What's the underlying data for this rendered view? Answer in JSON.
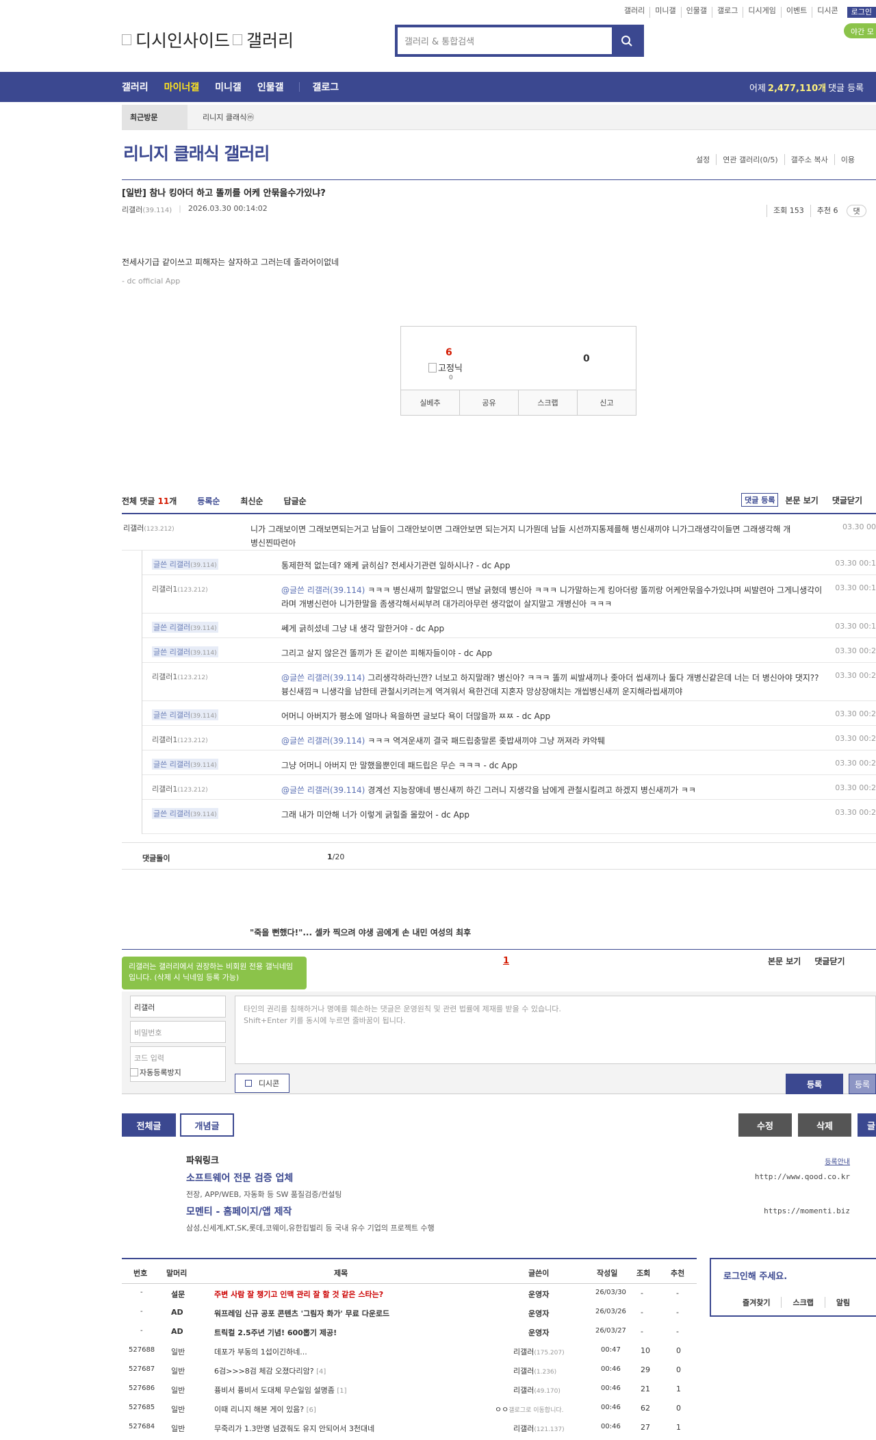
{
  "gnb": [
    "갤러리",
    "미니갤",
    "인물갤",
    "갤로그",
    "디시게임",
    "이벤트",
    "디시콘"
  ],
  "gnb_login": "로그인",
  "logo": [
    "디시인사이드",
    "갤러리"
  ],
  "search_placeholder": "갤러리 & 통합검색",
  "night_mode": "야간 모",
  "nav": {
    "items": [
      "갤러리",
      "마이너갤",
      "미니갤",
      "인물갤",
      "갤로그"
    ],
    "yesterday_prefix": "어제",
    "yesterday_count": "2,477,110개",
    "yesterday_suffix": "댓글 등록"
  },
  "recent": {
    "label": "최근방문",
    "item": "리니지 클래식ⓜ"
  },
  "gallery_title": "리니지 클래식 갤러리",
  "gallery_menu": [
    "설정",
    "연관 갤러리(0/5)",
    "갤주소 복사",
    "이용"
  ],
  "post": {
    "title": "[일반] 참나 킹아더 하고 똘끼를 어케 안묶을수가있냐?",
    "author": "리갤러",
    "author_ip": "(39.114)",
    "date": "2026.03.30 00:14:02",
    "views": "조회 153",
    "recommends": "추천 6",
    "body": "전세사기급 같이쓰고 피해자는 살자하고 그러는데 졸라어이없네",
    "app": "- dc official App"
  },
  "recommend": {
    "up": "6",
    "fixed": "고정닉",
    "fixed_count": "0",
    "down": "0",
    "buttons": [
      "실베추",
      "공유",
      "스크랩",
      "신고"
    ]
  },
  "comments_header": {
    "all": "전체 댓글",
    "count": "11",
    "suffix": "개",
    "sorts": [
      "등록순",
      "최신순",
      "답글순"
    ],
    "register": "댓글 등록",
    "view": "본문 보기",
    "close": "댓글닫기"
  },
  "main_comment": {
    "nick": "리갤러",
    "ip": "(123.212)",
    "text": "니가 그래보이면 그래보면되는거고 남들이 그래안보이면 그래안보면 되는거지 니가뭔데 남들 시선까지통제를해 병신새끼야 니가그래생각이들면 그래생각해 개병신찐따련아",
    "date": "03.30 00"
  },
  "replies": [
    {
      "nick": "글쓴 리갤러",
      "ip": "(39.114)",
      "gl": true,
      "at": "",
      "text": "통제한적 없는데? 왜케 긁히심? 전세사기관련 일하시나? - dc App",
      "date": "03.30 00:1"
    },
    {
      "nick": "리갤러1",
      "ip": "(123.212)",
      "gl": false,
      "at": "@글쓴 리갤러(39.114)",
      "text": " ㅋㅋㅋ 병신새끼 할말없으니 맨날 긁혔데 병신아 ㅋㅋㅋ 니가말하는게 킹아더랑 똘끼랑 어케안묶을수가있냐며 씨발련아 그게니생각이라며 개병신련아 니가한말을 좀생각해서씨부려 대가리아무런 생각없이 살지말고 개병신아 ㅋㅋㅋ",
      "date": "03.30 00:1"
    },
    {
      "nick": "글쓴 리갤러",
      "ip": "(39.114)",
      "gl": true,
      "at": "",
      "text": "쎄게 긁히셨네 그냥 내 생각 말한거야 - dc App",
      "date": "03.30 00:1"
    },
    {
      "nick": "글쓴 리갤러",
      "ip": "(39.114)",
      "gl": true,
      "at": "",
      "text": "그리고 살지 않은건 똘끼가 돈 같이쓴 피해자들이야 - dc App",
      "date": "03.30 00:2"
    },
    {
      "nick": "리갤러1",
      "ip": "(123.212)",
      "gl": false,
      "at": "@글쓴 리갤러(39.114)",
      "text": " 그리생각하라닌깐? 너보고 하지말래? 병신아? ㅋㅋㅋ 똘끼 씨발새끼나 좆아더 씹새끼나 둘다 개병신같은데 너는 더 병신아야 댓지?? 븅신새낌ㅋ 니생각을 남한테 관철시키려는게 역겨워서 욕한건데 지혼자 망상장애치는 개씹병신새끼 운지해라씹새끼야",
      "date": "03.30 00:2"
    },
    {
      "nick": "글쓴 리갤러",
      "ip": "(39.114)",
      "gl": true,
      "at": "",
      "text": "어머니 아버지가 평소에 얼마나 욕을하면 글보다 욕이 더많을까 ㅉㅉ - dc App",
      "date": "03.30 00:2"
    },
    {
      "nick": "리갤러1",
      "ip": "(123.212)",
      "gl": false,
      "at": "@글쓴 리갤러(39.114)",
      "text": " ㅋㅋㅋ 역겨운새끼 결국 패드립충말론 좆밥새끼야 그냥 꺼져라 캬악퉤",
      "date": "03.30 00:2"
    },
    {
      "nick": "글쓴 리갤러",
      "ip": "(39.114)",
      "gl": true,
      "at": "",
      "text": "그냥 어머니 아버지 만 말했을뿐인데 패드립은 무슨 ㅋㅋㅋ - dc App",
      "date": "03.30 00:2"
    },
    {
      "nick": "리갤러1",
      "ip": "(123.212)",
      "gl": false,
      "at": "@글쓴 리갤러(39.114)",
      "text": " 경계선 지능장애네 병신새끼 하긴 그러니 지생각을 남에게 관철시킬려고 하겠지 병신새끼가 ㅋㅋ",
      "date": "03.30 00:2"
    },
    {
      "nick": "글쓴 리갤러",
      "ip": "(39.114)",
      "gl": true,
      "at": "",
      "text": "그래 내가 미안해 너가 이렇게 긁힐줄 몰랐어 - dc App",
      "date": "03.30 00:2"
    }
  ],
  "comment_footer": {
    "label": "댓글돌이",
    "page": "1",
    "total": "/20"
  },
  "news": "\"죽을 뻔했다!\"... 셀카 찍으려 야생 곰에게 손 내민 여성의 최후",
  "tip": "리갤러는 갤러리에서 권장하는 비회원 전용 갤닉네임입니다. (삭제 시 닉네임 등록 가능)",
  "write": {
    "page": "1",
    "view": "본문 보기",
    "close": "댓글닫기",
    "nick": "리갤러",
    "password": "비밀번호",
    "code": "코드 입력",
    "captcha": "자동등록방지",
    "textarea": "타인의 권리를 침해하거나 명예를 훼손하는 댓글은 운영원칙 및 관련 법률에 제재를 받을 수 있습니다.\nShift+Enter 키를 동시에 누르면 줄바꿈이 됩니다.",
    "dccon": "디시콘",
    "register": "등록",
    "register2": "등록"
  },
  "board_buttons": {
    "all": "전체글",
    "concept": "개념글",
    "edit": "수정",
    "delete": "삭제",
    "write": "글"
  },
  "powerlink": {
    "title": "파워링크",
    "guide": "등록안내",
    "ads": [
      {
        "title": "소프트웨어 전문 검증 업체",
        "desc": "전장, APP/WEB, 자동화 등 SW 품질검증/컨설팅",
        "url": "http://www.qood.co.kr"
      },
      {
        "title": "모멘티 - 홈페이지/앱 제작",
        "desc": "삼성,신세계,KT,SK,롯데,코웨이,유한킴벌리 등 국내 유수 기업의 프로젝트 수행",
        "url": "https://momenti.biz"
      }
    ]
  },
  "list": {
    "headers": [
      "번호",
      "말머리",
      "제목",
      "글쓴이",
      "작성일",
      "조회",
      "추천"
    ],
    "rows": [
      {
        "no": "-",
        "head": "설문",
        "title": "주변 사람 잘 챙기고 인맥 관리 잘 할 것 같은 스타는?",
        "cnt": "",
        "writer": "운영자",
        "wip": "",
        "date": "26/03/30",
        "view": "-",
        "rec": "-",
        "style": "red"
      },
      {
        "no": "-",
        "head": "AD",
        "title": "워프레임 신규 공포 콘텐츠 '그림자 화가' 무료 다운로드",
        "cnt": "",
        "writer": "운영자",
        "wip": "",
        "date": "26/03/26",
        "view": "-",
        "rec": "-",
        "style": "bold"
      },
      {
        "no": "-",
        "head": "AD",
        "title": "트릭컬 2.5주년 기념! 600뽑기 제공!",
        "cnt": "",
        "writer": "운영자",
        "wip": "",
        "date": "26/03/27",
        "view": "-",
        "rec": "-",
        "style": "bold"
      },
      {
        "no": "527688",
        "head": "일반",
        "title": "데포가 부동의 1섭이긴하네...",
        "cnt": "",
        "writer": "리갤러",
        "wip": "(175.207)",
        "date": "00:47",
        "view": "10",
        "rec": "0",
        "style": ""
      },
      {
        "no": "527687",
        "head": "일반",
        "title": "6검>>>8검 체감 오졌다리암?",
        "cnt": "[4]",
        "writer": "리갤러",
        "wip": "(1.236)",
        "date": "00:46",
        "view": "29",
        "rec": "0",
        "style": ""
      },
      {
        "no": "527686",
        "head": "일반",
        "title": "퓽비서 퓽비서 도대체 무슨일임 설명좀",
        "cnt": "[1]",
        "writer": "리갤러",
        "wip": "(49.170)",
        "date": "00:46",
        "view": "21",
        "rec": "1",
        "style": ""
      },
      {
        "no": "527685",
        "head": "일반",
        "title": "이때 리니지 해본 게이 있음?",
        "cnt": "[6]",
        "writer": "ㅇㅇ",
        "wip": "갤로그로 이동합니다.",
        "date": "00:46",
        "view": "62",
        "rec": "0",
        "style": ""
      },
      {
        "no": "527684",
        "head": "일반",
        "title": "무죽리가 1.3만명 넘겼줘도 유지 안되어서 3천대네",
        "cnt": "",
        "writer": "리갤러",
        "wip": "(121.137)",
        "date": "00:46",
        "view": "27",
        "rec": "1",
        "style": ""
      }
    ]
  },
  "loginbox": {
    "title": "로그인해 주세요.",
    "menu": [
      "즐겨찾기",
      "스크랩",
      "알림"
    ]
  },
  "colors": {
    "brand": "#3b4890",
    "accent": "#ffe41e",
    "red": "#d31900",
    "green": "#8bc34a"
  }
}
